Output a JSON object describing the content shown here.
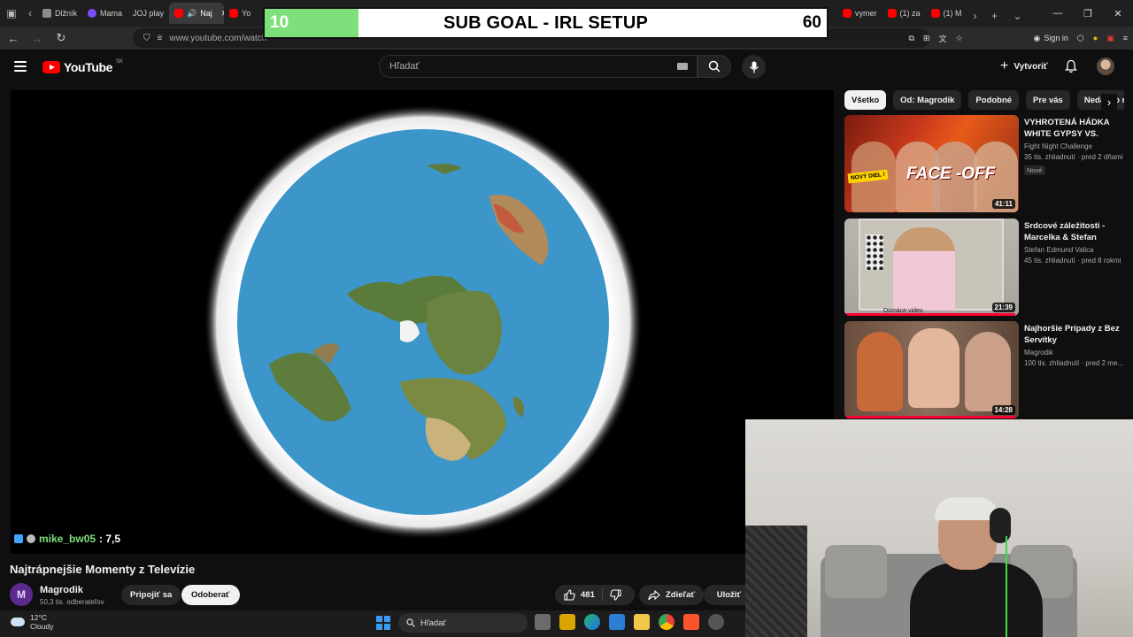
{
  "browser": {
    "tabs": [
      {
        "label": "Dlžník",
        "favicon": "gray"
      },
      {
        "label": "Mama",
        "favicon": "purple"
      },
      {
        "label": "JOJ play",
        "favicon": "none"
      },
      {
        "label": "Naj",
        "favicon": "yt",
        "active": true,
        "audio": true
      },
      {
        "label": "Yo",
        "favicon": "yt"
      }
    ],
    "tabs_right": [
      {
        "label": "vymer",
        "favicon": "yt"
      },
      {
        "label": "(1) za",
        "favicon": "yt"
      },
      {
        "label": "(1) M",
        "favicon": "yt"
      }
    ],
    "url": "www.youtube.com/watch",
    "sign_in": "Sign in"
  },
  "overlay": {
    "current": "10",
    "title": "SUB GOAL - IRL SETUP",
    "goal": "60",
    "progress": 0.167
  },
  "youtube": {
    "logo_text": "YouTube",
    "region": "SK",
    "search_placeholder": "Hľadať",
    "create_label": "Vytvoriť"
  },
  "player": {
    "chat_user": "mike_bw05",
    "chat_message": ": 7,5"
  },
  "video": {
    "title": "Najtrápnejšie Momenty z Televízie",
    "channel": "Magrodik",
    "subscribers": "50,3 tis. odberateľov",
    "join_label": "Pripojiť sa",
    "subscribe_label": "Odoberať",
    "likes": "481",
    "share_label": "Zdieľať",
    "save_label": "Uložiť"
  },
  "chips": [
    "Všetko",
    "Od: Magrodik",
    "Podobné",
    "Pre vás",
    "Nedávno nahrané"
  ],
  "recommendations": [
    {
      "title": "VYHROTENÁ HÁDKA WHITE GYPSY VS. DEKÝ...",
      "channel": "Fight Night Challenge",
      "stats": "35 tis. zhliadnutí · pred 2 dňami",
      "badge": "Nové",
      "duration": "41:11",
      "thumb_text": "FACE -OFF",
      "thumb_badge": "NOVÝ DIEL !",
      "watched": 0.0
    },
    {
      "title": "Srdcové záležitosti - Marcelka & Stefan",
      "channel": "Stefan Edmund Valica",
      "stats": "45 tis. zhliadnutí · pred 8 rokmi",
      "badge": "",
      "duration": "21:39",
      "thumb_text": "Domáce video",
      "thumb_badge": "",
      "watched": 0.98
    },
    {
      "title": "Najhoršie Prípady z Bez Servítky",
      "channel": "Magrodik",
      "stats": "100 tis. zhliadnutí · pred 2 me...",
      "badge": "",
      "duration": "14:28",
      "thumb_text": "",
      "thumb_badge": "",
      "watched": 0.98
    }
  ],
  "taskbar": {
    "temperature": "12°C",
    "weather": "Cloudy",
    "search_placeholder": "Hľadať"
  },
  "colors": {
    "accent_red": "#ff0000",
    "chat_green": "#7de07a",
    "goal_green": "#7de07a"
  }
}
